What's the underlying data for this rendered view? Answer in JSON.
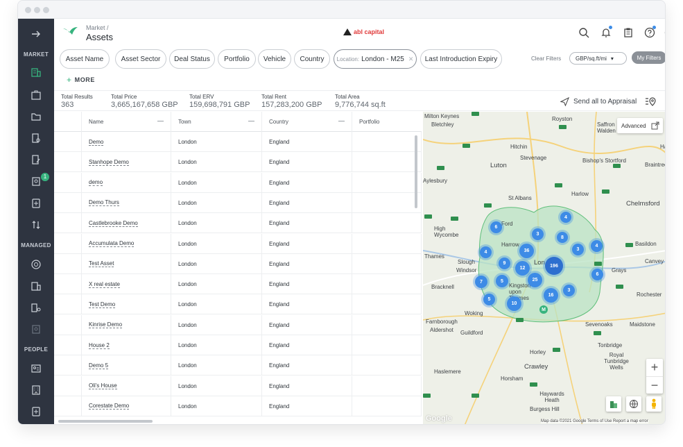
{
  "header": {
    "breadcrumb": "Market /",
    "title": "Assets",
    "brand": "abl capital"
  },
  "sidebar": {
    "sections": [
      "MARKET",
      "MANAGED",
      "PEOPLE"
    ],
    "badge": "1",
    "icons": [
      "arrow-right-icon",
      "building-icon",
      "briefcase-icon",
      "folder-icon",
      "document-search-icon",
      "edit-document-icon",
      "search-report-icon",
      "add-document-icon",
      "sort-icon",
      "target-icon",
      "building-managed-icon",
      "building-search-icon",
      "report-icon",
      "id-card-icon",
      "office-building-icon",
      "add-file-icon"
    ]
  },
  "filters": {
    "chips": [
      "Asset Name",
      "Asset Sector",
      "Deal Status",
      "Portfolio",
      "Vehicle",
      "Country"
    ],
    "location_prefix": "Location:",
    "location_value": "London - M25",
    "last_chip": "Last Introduction Expiry",
    "clear": "Clear Filters",
    "unit_select": "GBP/sq.ft/mi",
    "my_filters": "My Filters",
    "more": "MORE"
  },
  "stats": [
    {
      "label": "Total Results",
      "value": "363"
    },
    {
      "label": "Total Price",
      "value": "3,665,167,658 GBP"
    },
    {
      "label": "Total ERV",
      "value": "159,698,791 GBP"
    },
    {
      "label": "Total Rent",
      "value": "157,283,200 GBP"
    },
    {
      "label": "Total Area",
      "value": "9,776,744 sq.ft"
    }
  ],
  "appraisal": "Send all to Appraisal",
  "table": {
    "columns": [
      "Name",
      "Town",
      "Country",
      "Portfolio"
    ],
    "rows": [
      {
        "name": "Demo",
        "town": "London",
        "country": "England"
      },
      {
        "name": "Stanhope Demo",
        "town": "London",
        "country": "England"
      },
      {
        "name": "demo",
        "town": "London",
        "country": "England"
      },
      {
        "name": "Demo Thurs",
        "town": "London",
        "country": "England"
      },
      {
        "name": "Castlebrooke Demo",
        "town": "London",
        "country": "England"
      },
      {
        "name": "Accumulata Demo",
        "town": "London",
        "country": "England"
      },
      {
        "name": "Test Asset",
        "town": "London",
        "country": "England"
      },
      {
        "name": "X real estate",
        "town": "London",
        "country": "England"
      },
      {
        "name": "Test Demo",
        "town": "London",
        "country": "England"
      },
      {
        "name": "Kinrise Demo",
        "town": "London",
        "country": "England"
      },
      {
        "name": "House 2",
        "town": "London",
        "country": "England"
      },
      {
        "name": "Demo 5",
        "town": "London",
        "country": "England"
      },
      {
        "name": "Oli's House",
        "town": "London",
        "country": "England"
      },
      {
        "name": "Corestate Demo",
        "town": "London",
        "country": "England"
      }
    ]
  },
  "map": {
    "advanced": "Advanced",
    "places": [
      "Milton Keynes",
      "Bletchley",
      "Royston",
      "Saffron Walden",
      "Hitchin",
      "Stevenage",
      "Luton",
      "Bishop's Stortford",
      "Braintree",
      "Aylesbury",
      "St Albans",
      "Harlow",
      "Chelmsford",
      "High Wycombe",
      "Basildon",
      "Slough",
      "Windsor",
      "Lon",
      "Grays",
      "Bracknell",
      "Kingston upon Thames",
      "Rochester",
      "Woking",
      "Farnborough",
      "Aldershot",
      "Guildford",
      "Sevenoaks",
      "Maidstone",
      "Tonbridge",
      "Royal Tunbridge Wells",
      "Horley",
      "Crawley",
      "Haslemere",
      "Horsham",
      "Haywards Heath",
      "Burgess Hill",
      "Harrow",
      "Thames",
      "Canvey Is",
      "Ha",
      "Ford"
    ],
    "clusters": [
      "4",
      "6",
      "3",
      "8",
      "9",
      "36",
      "3",
      "4",
      "M",
      "12",
      "196",
      "6",
      "7",
      "5",
      "25",
      "3",
      "16",
      "10",
      "5",
      "4"
    ],
    "attribution": "Map data ©2021 Google   Terms of Use   Report a map error",
    "google": "Google",
    "colors": {
      "radius_fill": "#b9e3c4",
      "cluster": "#3d8be6",
      "water_green": "#2f8f4e"
    }
  }
}
